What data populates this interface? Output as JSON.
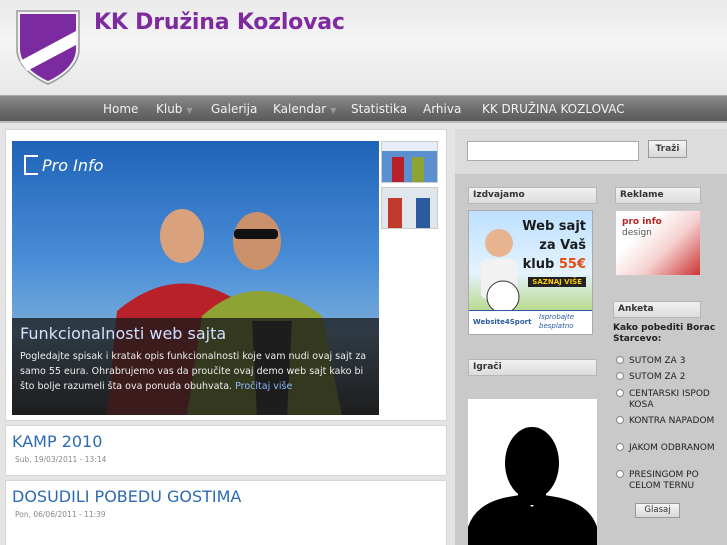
{
  "site": {
    "title": "KK Družina Kozlovac"
  },
  "nav": [
    {
      "label": "Home",
      "dropdown": false
    },
    {
      "label": "Klub",
      "dropdown": true
    },
    {
      "label": "Galerija",
      "dropdown": false
    },
    {
      "label": "Kalendar",
      "dropdown": true
    },
    {
      "label": "Statistika",
      "dropdown": false
    },
    {
      "label": "Arhiva",
      "dropdown": false
    },
    {
      "label": "KK DRUŽINA KOZLOVAC",
      "dropdown": false
    }
  ],
  "slider": {
    "logo_text": "Pro Info",
    "title": "Funkcionalnosti web sajta",
    "text": "Pogledajte spisak i kratak opis funkcionalnosti koje vam nudi ovaj sajt za samo 55 eura. Ohrabrujemo vas da proučite ovaj demo web sajt kako bi što bolje razumeli šta ova ponuda obuhvata.",
    "more_link": "Pročitaj više"
  },
  "posts": [
    {
      "title": "KAMP 2010",
      "date": "Sub, 19/03/2011 - 13:14"
    },
    {
      "title": "DOSUDILI POBEDU GOSTIMA",
      "date": "Pon, 06/06/2011 - 11:39"
    }
  ],
  "search": {
    "button": "Traži",
    "placeholder": ""
  },
  "blocks": {
    "featured": "Izdvajamo",
    "ads": "Reklame",
    "poll": "Anketa",
    "players": "Igrači"
  },
  "featured_ad": {
    "line1": "Web sajt",
    "line2": "za Vaš",
    "line3": "klub",
    "price": "55€",
    "button": "SAZNAJ VIŠE",
    "brand": "Website4Sport",
    "cta": "Isprobajte besplatno"
  },
  "ad_banner": {
    "line1": "pro info",
    "line2": "design"
  },
  "poll": {
    "question": "Kako pobediti Borac Starcevo:",
    "options": [
      "SUTOM ZA 3",
      "SUTOM ZA 2",
      "CENTARSKI ISPOD KOSA",
      "KONTRA NAPADOM",
      "JAKOM ODBRANOM",
      "PRESINGOM PO CELOM TERNU"
    ],
    "vote_button": "Glasaj"
  },
  "colors": {
    "title": "#7f2a9e",
    "nav_bg": "#6f6f6f",
    "link": "#2c6ab3"
  }
}
